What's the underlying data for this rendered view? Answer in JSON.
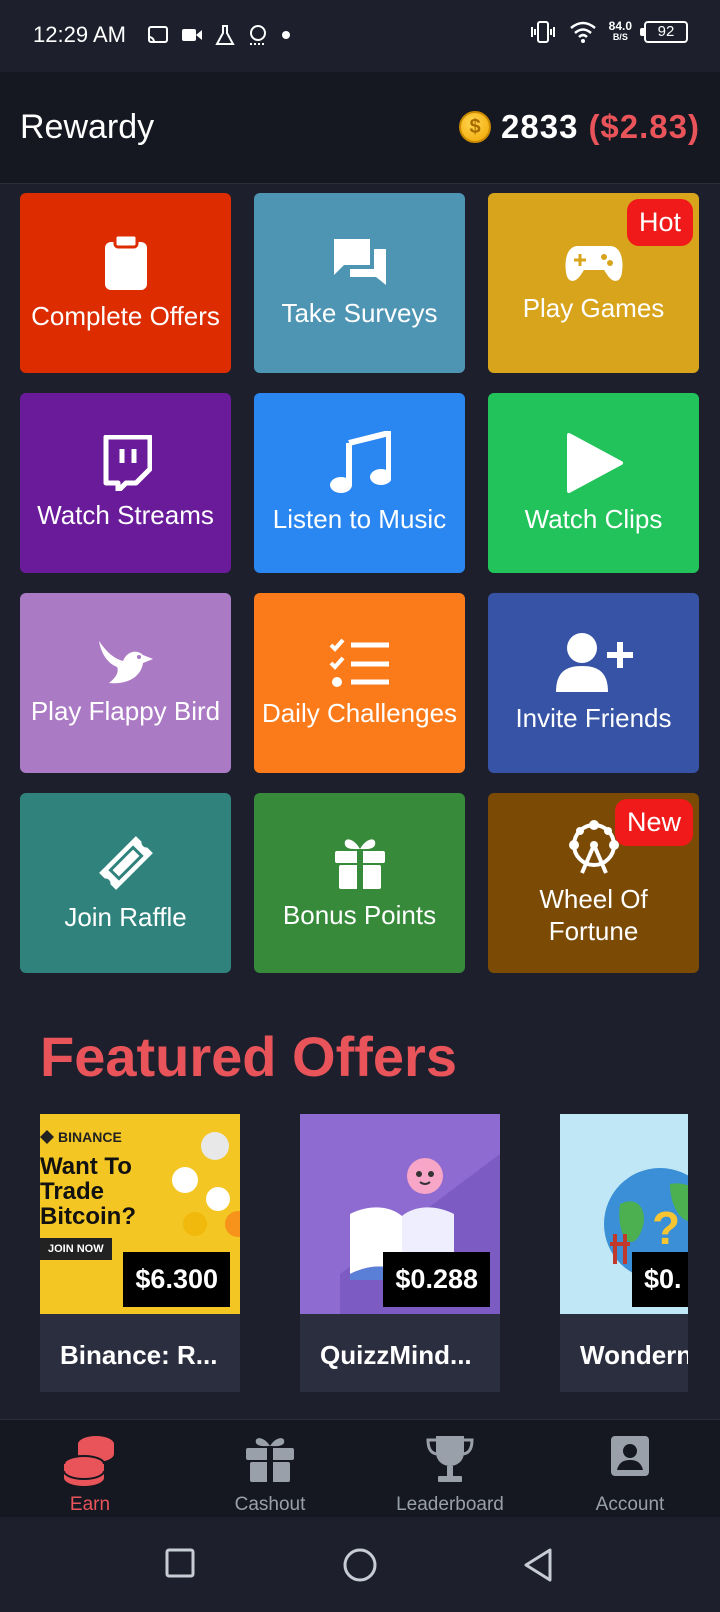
{
  "status_bar": {
    "time": "12:29 AM",
    "speed_value": "84.0",
    "speed_unit": "B/S",
    "battery": "92"
  },
  "app_bar": {
    "title": "Rewardy",
    "points": "2833",
    "usd": "($2.83)",
    "coin_symbol": "$"
  },
  "tiles": [
    {
      "label": "Complete Offers",
      "icon": "clipboard-icon",
      "color": "#dd2c00"
    },
    {
      "label": "Take Surveys",
      "icon": "chat-icon",
      "color": "#4e95b4"
    },
    {
      "label": "Play Games",
      "icon": "gamepad-icon",
      "color": "#d8a41c",
      "badge": "Hot"
    },
    {
      "label": "Watch Streams",
      "icon": "twitch-icon",
      "color": "#6a1b9a"
    },
    {
      "label": "Listen to Music",
      "icon": "music-note-icon",
      "color": "#2a86f0"
    },
    {
      "label": "Watch Clips",
      "icon": "play-icon",
      "color": "#22c35b"
    },
    {
      "label": "Play Flappy Bird",
      "icon": "bird-icon",
      "color": "#ab7ac4"
    },
    {
      "label": "Daily Challenges",
      "icon": "checklist-icon",
      "color": "#fb7b1b"
    },
    {
      "label": "Invite Friends",
      "icon": "add-user-icon",
      "color": "#3653a5"
    },
    {
      "label": "Join Raffle",
      "icon": "ticket-icon",
      "color": "#2f837c"
    },
    {
      "label": "Bonus Points",
      "icon": "gift-icon",
      "color": "#368a3a"
    },
    {
      "label": "Wheel Of Fortune",
      "icon": "ferris-wheel-icon",
      "color": "#7b4a05",
      "badge": "New"
    }
  ],
  "featured": {
    "title": "Featured Offers",
    "offers": [
      {
        "name": "Binance: R...",
        "price": "$6.300",
        "brand": "BINANCE",
        "headline": "Want To Trade Bitcoin?",
        "cta": "JOIN NOW"
      },
      {
        "name": "QuizzMind...",
        "price": "$0.288"
      },
      {
        "name": "Wondern",
        "price": "$0."
      }
    ]
  },
  "bottom_nav": [
    {
      "label": "Earn",
      "icon": "coins-icon",
      "active": true
    },
    {
      "label": "Cashout",
      "icon": "gift-icon",
      "active": false
    },
    {
      "label": "Leaderboard",
      "icon": "trophy-icon",
      "active": false
    },
    {
      "label": "Account",
      "icon": "account-icon",
      "active": false
    }
  ]
}
